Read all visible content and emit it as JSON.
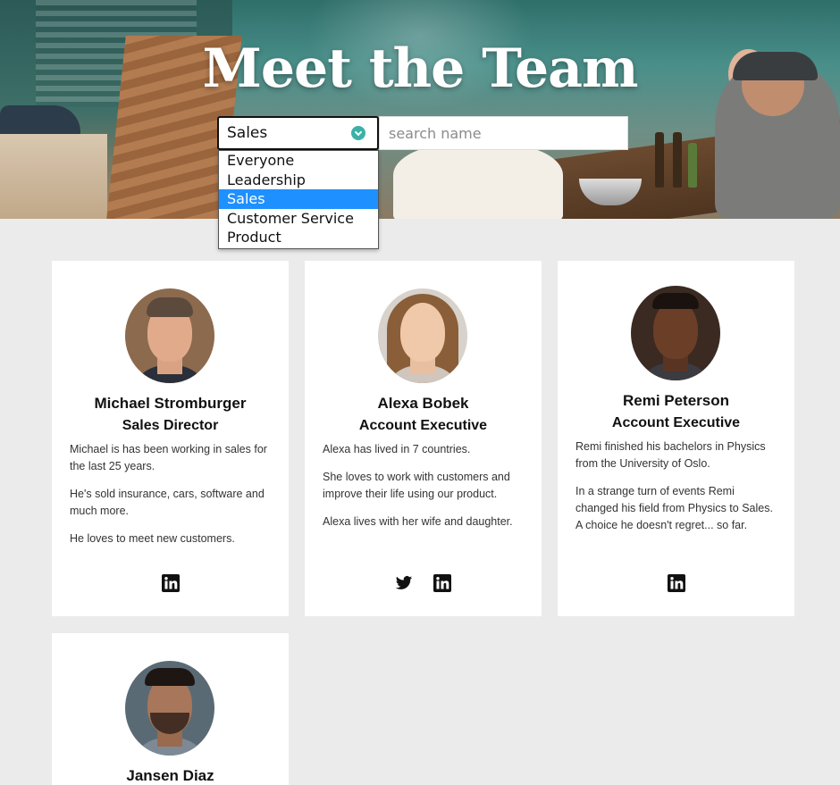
{
  "hero": {
    "title": "Meet the Team"
  },
  "filter": {
    "selected": "Sales",
    "options": [
      "Everyone",
      "Leadership",
      "Sales",
      "Customer Service",
      "Product"
    ],
    "search_placeholder": "search name"
  },
  "team": [
    {
      "name": "Michael Stromburger",
      "role": "Sales Director",
      "bio": [
        "Michael is has been working in sales for the last 25 years.",
        "He's sold insurance, cars, software and much more.",
        "He loves to meet new customers."
      ],
      "socials": [
        "linkedin-icon"
      ]
    },
    {
      "name": "Alexa Bobek",
      "role": "Account Executive",
      "bio": [
        "Alexa has lived in 7 countries.",
        "She loves to work with customers and improve their life using our product.",
        "Alexa lives with her wife and daughter."
      ],
      "socials": [
        "twitter-icon",
        "linkedin-icon"
      ]
    },
    {
      "name": "Remi Peterson",
      "role": "Account Executive",
      "bio": [
        "Remi finished his bachelors in Physics from the University of Oslo.",
        "In a strange turn of events Remi changed his field from Physics to Sales. A choice he doesn't regret... so far."
      ],
      "socials": [
        "linkedin-icon"
      ]
    },
    {
      "name": "Jansen Diaz",
      "role": "",
      "bio": [],
      "socials": []
    }
  ],
  "colors": {
    "page_bg": "#ebebeb",
    "accent": "#3bb1a8",
    "selected_option": "#1e90ff"
  }
}
